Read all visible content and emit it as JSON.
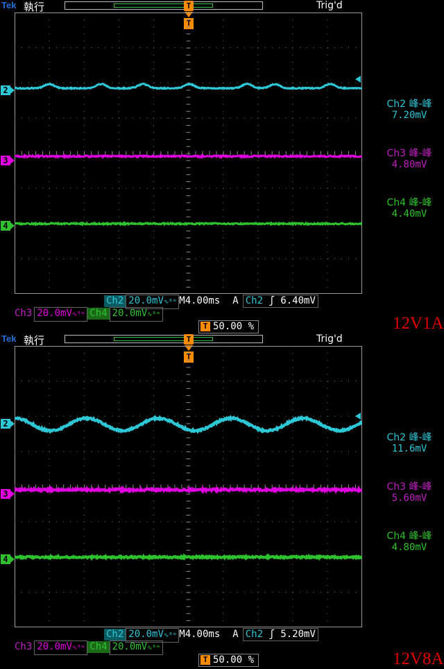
{
  "colors": {
    "ch2": "#2ec7d6",
    "ch3": "#e000e0",
    "ch4": "#2ec22e",
    "ch3_meas": "#c020c0",
    "brand": "#1e6fd6",
    "trigger": "#ff8c00",
    "footer": "#e00000"
  },
  "icons": {
    "trigger_position": "orange-T-trigger-icon",
    "trigger_slope": "rising-edge-icon",
    "coupling": "bandwidth-limit-icon"
  },
  "panels": [
    {
      "status": {
        "brand": "Tek",
        "run_state": "執行",
        "trig_state": "Trig'd"
      },
      "channels": [
        {
          "marker": "2"
        },
        {
          "marker": "3"
        },
        {
          "marker": "4"
        }
      ],
      "measurements": [
        {
          "label": "Ch2 峰-峰",
          "value": "7.20mV"
        },
        {
          "label": "Ch3 峰-峰",
          "value": "4.80mV"
        },
        {
          "label": "Ch4 峰-峰",
          "value": "4.40mV"
        }
      ],
      "bottom": {
        "ch2_label": "Ch2",
        "ch2_scale": "20.0mV",
        "timebase": "M4.00ms",
        "trig_mode": "A",
        "trig_source": "Ch2",
        "trig_slope": "ʃ",
        "trig_level": "6.40mV",
        "ch3_label": "Ch3",
        "ch3_scale": "20.0mV",
        "ch4_label": "Ch4",
        "ch4_scale": "20.0mV",
        "trig_position": "50.00 %",
        "trig_position_icon": "T"
      },
      "footer_label": "12V1A"
    },
    {
      "status": {
        "brand": "Tek",
        "run_state": "執行",
        "trig_state": "Trig'd"
      },
      "channels": [
        {
          "marker": "2"
        },
        {
          "marker": "3"
        },
        {
          "marker": "4"
        }
      ],
      "measurements": [
        {
          "label": "Ch2 峰-峰",
          "value": "11.6mV"
        },
        {
          "label": "Ch3 峰-峰",
          "value": "5.60mV"
        },
        {
          "label": "Ch4 峰-峰",
          "value": "4.80mV"
        }
      ],
      "bottom": {
        "ch2_label": "Ch2",
        "ch2_scale": "20.0mV",
        "timebase": "M4.00ms",
        "trig_mode": "A",
        "trig_source": "Ch2",
        "trig_slope": "ʃ",
        "trig_level": "5.20mV",
        "ch3_label": "Ch3",
        "ch3_scale": "20.0mV",
        "ch4_label": "Ch4",
        "ch4_scale": "20.0mV",
        "trig_position": "50.00 %",
        "trig_position_icon": "T"
      },
      "footer_label": "12V8A"
    }
  ]
}
